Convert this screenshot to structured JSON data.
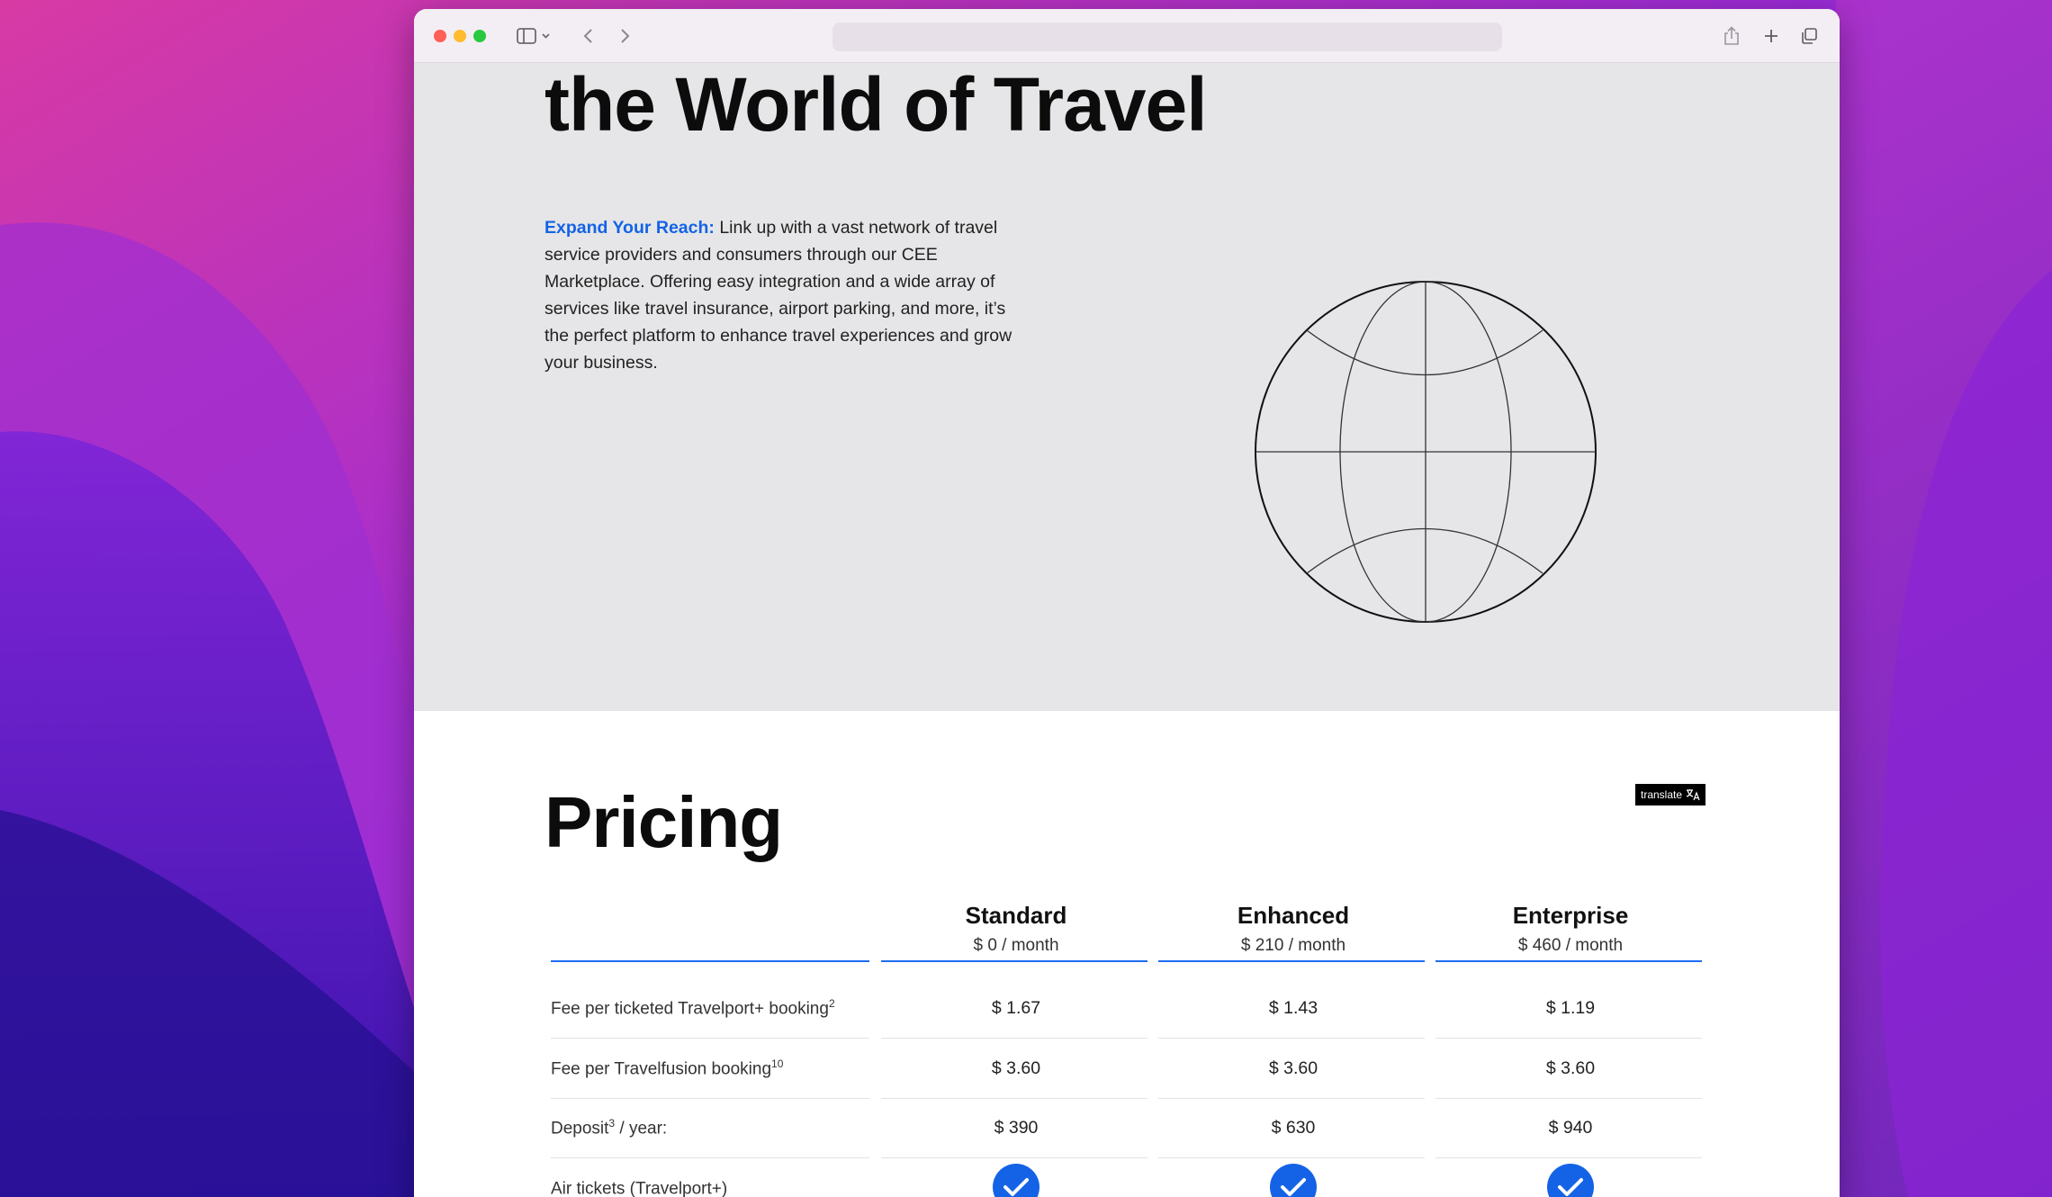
{
  "hero": {
    "title": "the World of Travel",
    "lead": "Expand Your Reach:",
    "body": " Link up with a vast network of travel service providers and consumers through our CEE Marketplace. Offering easy integration and a wide array of services like travel insurance, airport parking, and more, it’s the perfect platform to enhance travel experiences and grow your business."
  },
  "pricing": {
    "title": "Pricing",
    "translate_label": "translate",
    "plans": [
      {
        "name": "Standard",
        "price": "$ 0 / month"
      },
      {
        "name": "Enhanced",
        "price": "$ 210 / month"
      },
      {
        "name": "Enterprise",
        "price": "$ 460 / month"
      }
    ],
    "rows": [
      {
        "label": "Fee per ticketed Travelport+ booking",
        "sup": "2",
        "suffix": "",
        "values": [
          "$ 1.67",
          "$ 1.43",
          "$ 1.19"
        ]
      },
      {
        "label": "Fee per Travelfusion booking",
        "sup": "10",
        "suffix": "",
        "values": [
          "$ 3.60",
          "$ 3.60",
          "$ 3.60"
        ]
      },
      {
        "label": "Deposit",
        "sup": "3",
        "suffix": " / year:",
        "values": [
          "$ 390",
          "$ 630",
          "$ 940"
        ]
      },
      {
        "label": "Air tickets (Travelport+)",
        "sup": "",
        "suffix": "",
        "values": [
          "check",
          "check",
          "check"
        ]
      }
    ]
  },
  "colors": {
    "accent": "#1463e6",
    "hero_bg": "#e6e6e8"
  },
  "icons": {
    "check": "checkmark-circle-icon",
    "globe": "globe-icon"
  }
}
